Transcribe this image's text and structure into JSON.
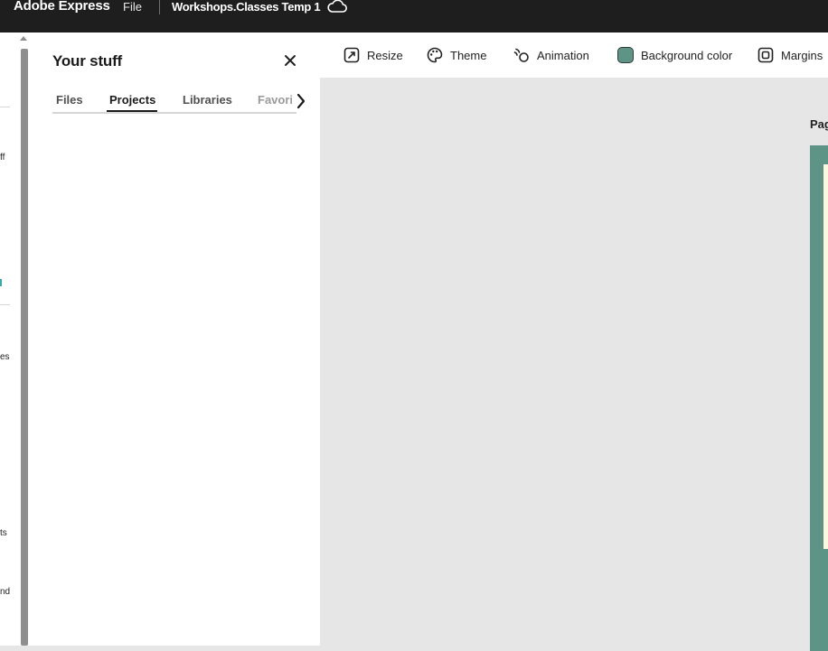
{
  "topbar": {
    "brand": "Adobe Express",
    "file_menu": "File",
    "doc_title": "Workshops.Classes Temp 1",
    "cloud_icon": "cloud-icon"
  },
  "left_rail": {
    "labels": [
      "ff",
      "es",
      "ts",
      "nd"
    ]
  },
  "panel": {
    "title": "Your stuff",
    "tabs": [
      "Files",
      "Projects",
      "Libraries",
      "Favorites"
    ],
    "active_tab": "Projects"
  },
  "toolbar": {
    "items": [
      {
        "label": "Resize",
        "icon": "resize-icon"
      },
      {
        "label": "Theme",
        "icon": "palette-icon"
      },
      {
        "label": "Animation",
        "icon": "animation-icon"
      },
      {
        "label": "Background color",
        "icon": "color-swatch"
      },
      {
        "label": "Margins",
        "icon": "margins-icon"
      }
    ]
  },
  "canvas": {
    "page_label": "Pag",
    "page_color": "#5d9485",
    "inner_color": "#fbf8df"
  },
  "colors": {
    "topbar_bg": "#1e1e1e",
    "canvas_bg": "#e6e6e6",
    "bg_swatch": "#5d9485",
    "accent": "#3aa6b0"
  }
}
